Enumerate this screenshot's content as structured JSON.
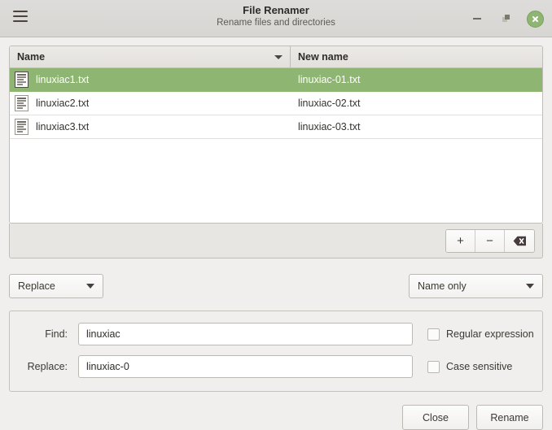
{
  "window": {
    "title": "File Renamer",
    "subtitle": "Rename files and directories",
    "menu_icon": "hamburger-menu-icon",
    "controls": {
      "minimize": "minimize-icon",
      "maximize": "maximize-icon",
      "close": "close-icon"
    },
    "accent_green": "#8fb573",
    "background": "#f0efee"
  },
  "file_list": {
    "columns": [
      {
        "label": "Name",
        "sorted": true,
        "sort_direction": "descending"
      },
      {
        "label": "New name",
        "sorted": false
      }
    ],
    "rows": [
      {
        "icon": "text-file-icon",
        "name": "linuxiac1.txt",
        "new_name": "linuxiac-01.txt",
        "selected": true
      },
      {
        "icon": "text-file-icon",
        "name": "linuxiac2.txt",
        "new_name": "linuxiac-02.txt",
        "selected": false
      },
      {
        "icon": "text-file-icon",
        "name": "linuxiac3.txt",
        "new_name": "linuxiac-03.txt",
        "selected": false
      }
    ],
    "toolbar": {
      "add_label": "+",
      "add_name": "add-files-button",
      "remove_label": "−",
      "remove_name": "remove-file-button",
      "clear_label": "clear-list-icon",
      "clear_name": "clear-list-button"
    }
  },
  "options": {
    "mode": {
      "value": "Replace",
      "caret": "chevron-down-icon"
    },
    "scope": {
      "value": "Name only",
      "caret": "chevron-down-icon"
    }
  },
  "find_replace": {
    "find_label": "Find:",
    "find_value": "linuxiac",
    "find_placeholder": "",
    "replace_label": "Replace:",
    "replace_value": "linuxiac-0",
    "replace_placeholder": "",
    "regex_label": "Regular expression",
    "regex_checked": false,
    "case_label": "Case sensitive",
    "case_checked": false
  },
  "footer": {
    "close_label": "Close",
    "rename_label": "Rename"
  }
}
